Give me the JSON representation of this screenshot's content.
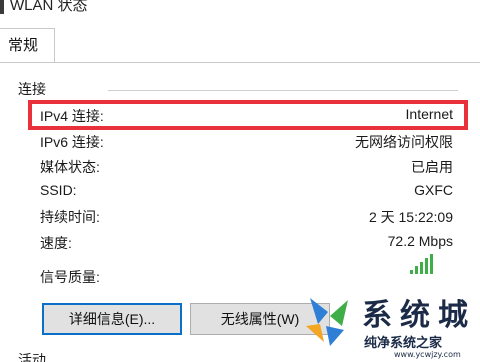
{
  "window": {
    "title": "WLAN 状态"
  },
  "tabs": [
    {
      "label": "常规",
      "active": true
    }
  ],
  "connection": {
    "section_label": "连接",
    "rows": [
      {
        "label": "IPv4 连接:",
        "value": "Internet",
        "highlighted": true
      },
      {
        "label": "IPv6 连接:",
        "value": "无网络访问权限"
      },
      {
        "label": "媒体状态:",
        "value": "已启用"
      },
      {
        "label": "SSID:",
        "value": "GXFC"
      },
      {
        "label": "持续时间:",
        "value": "2 天 15:22:09"
      },
      {
        "label": "速度:",
        "value": "72.2 Mbps"
      },
      {
        "label": "信号质量:",
        "value": ""
      }
    ],
    "signal_icon": "signal-bars-icon",
    "signal_level_bars": 5
  },
  "buttons": {
    "details": "详细信息(E)...",
    "wireless_properties": "无线属性(W)"
  },
  "activity": {
    "section_label": "活动"
  },
  "watermark": {
    "name": "系统城",
    "tagline": "纯净系统之家",
    "url": "www.ycwjzy.com"
  },
  "colors": {
    "highlight_border": "#e8313a",
    "primary_button_border": "#0b6ec9",
    "signal_green": "#3fae49"
  }
}
